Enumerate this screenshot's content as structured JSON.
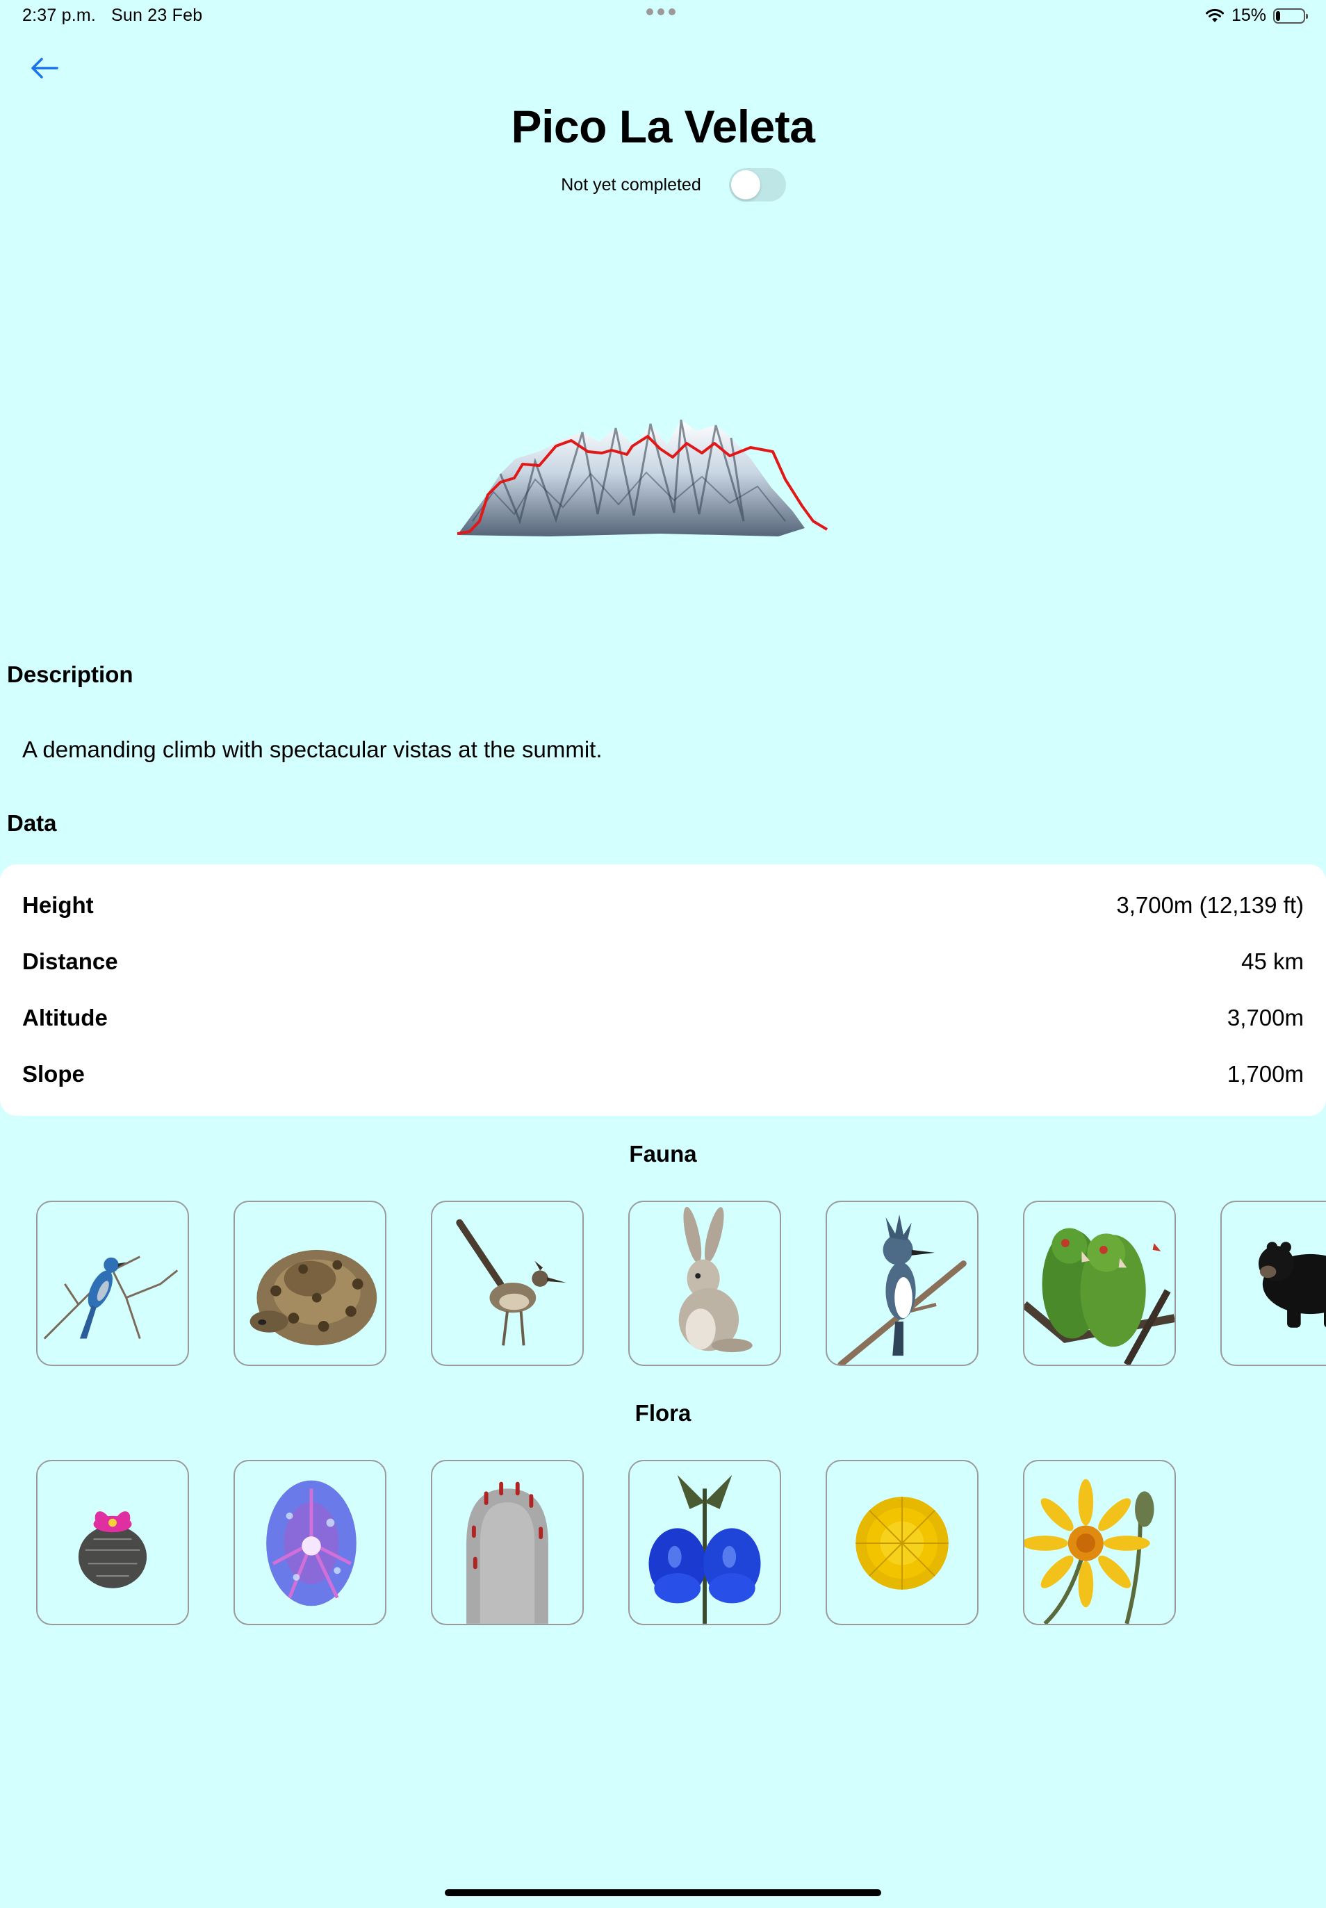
{
  "status_bar": {
    "time": "2:37 p.m.",
    "date": "Sun 23 Feb",
    "battery_percent": "15%",
    "battery_level": 0.15
  },
  "header": {
    "back_icon": "arrow-left-icon",
    "title": "Pico La Veleta",
    "completed_label": "Not yet completed",
    "completed": false
  },
  "description": {
    "heading": "Description",
    "text": "A demanding climb with spectacular vistas at the summit."
  },
  "data": {
    "heading": "Data",
    "rows": [
      {
        "label": "Height",
        "value": "3,700m (12,139 ft)"
      },
      {
        "label": "Distance",
        "value": "45 km"
      },
      {
        "label": "Altitude",
        "value": "3,700m"
      },
      {
        "label": "Slope",
        "value": "1,700m"
      }
    ]
  },
  "fauna": {
    "heading": "Fauna",
    "items": [
      "blue-jay",
      "rattlesnake",
      "roadrunner",
      "jackrabbit",
      "kingfisher",
      "parrots",
      "black-bear"
    ]
  },
  "flora": {
    "heading": "Flora",
    "items": [
      "cactus-pink-flower",
      "morning-glory",
      "pincushion-cactus",
      "blue-sage",
      "dandelion",
      "sunflower"
    ]
  },
  "colors": {
    "background": "#d4ffff",
    "accent": "#1a73e8",
    "profile_line": "#e01818"
  }
}
